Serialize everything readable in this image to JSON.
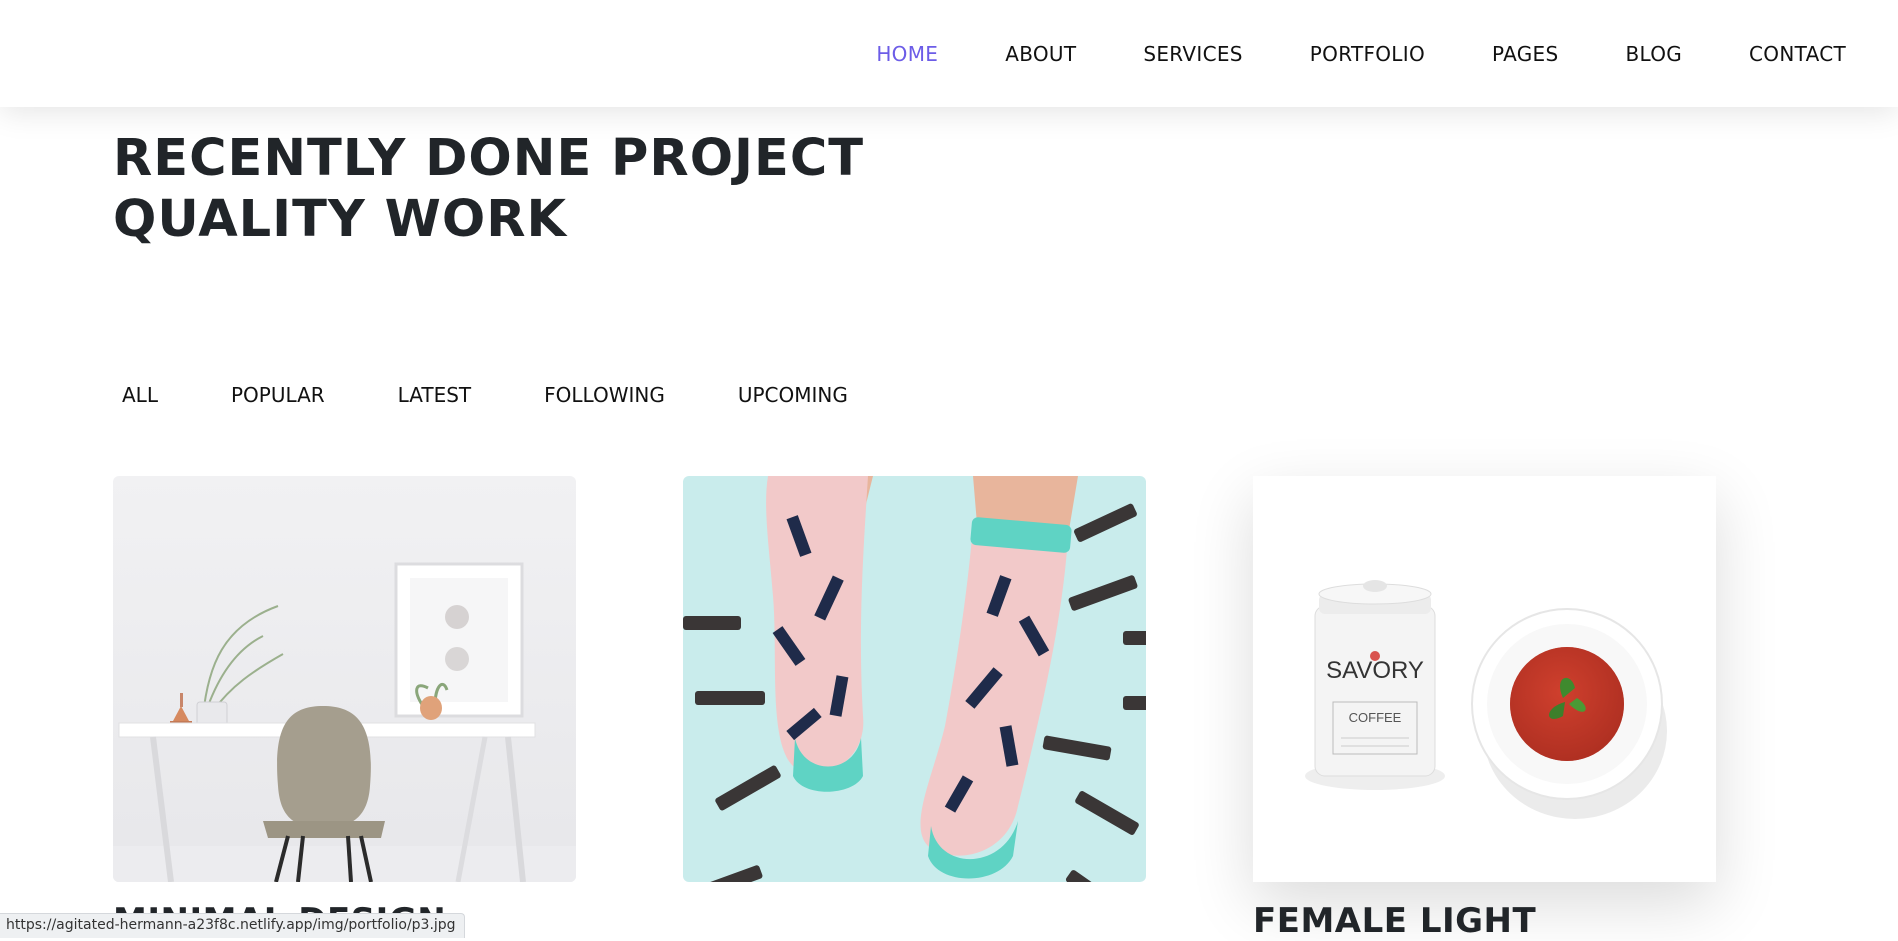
{
  "nav": {
    "items": [
      {
        "label": "HOME",
        "active": true
      },
      {
        "label": "ABOUT",
        "active": false
      },
      {
        "label": "SERVICES",
        "active": false
      },
      {
        "label": "PORTFOLIO",
        "active": false
      },
      {
        "label": "PAGES",
        "active": false
      },
      {
        "label": "BLOG",
        "active": false
      },
      {
        "label": "CONTACT",
        "active": false
      }
    ],
    "active_color": "#6c5ce7"
  },
  "heading": {
    "line1": "RECENTLY DONE PROJECT",
    "line2": "QUALITY WORK"
  },
  "filters": {
    "items": [
      "ALL",
      "POPULAR",
      "LATEST",
      "FOLLOWING",
      "UPCOMING"
    ]
  },
  "portfolio": {
    "cards": [
      {
        "title": "MINIMAL DESIGN",
        "image": "desk-chair-photo"
      },
      {
        "title": "",
        "image": "socks-photo"
      },
      {
        "title": "FEMALE LIGHT",
        "image": "coffee-soup-photo",
        "brand_text": "SAVORY",
        "label_text": "COFFEE"
      }
    ]
  },
  "status_bar": {
    "url": "https://agitated-hermann-a23f8c.netlify.app/img/portfolio/p3.jpg"
  }
}
